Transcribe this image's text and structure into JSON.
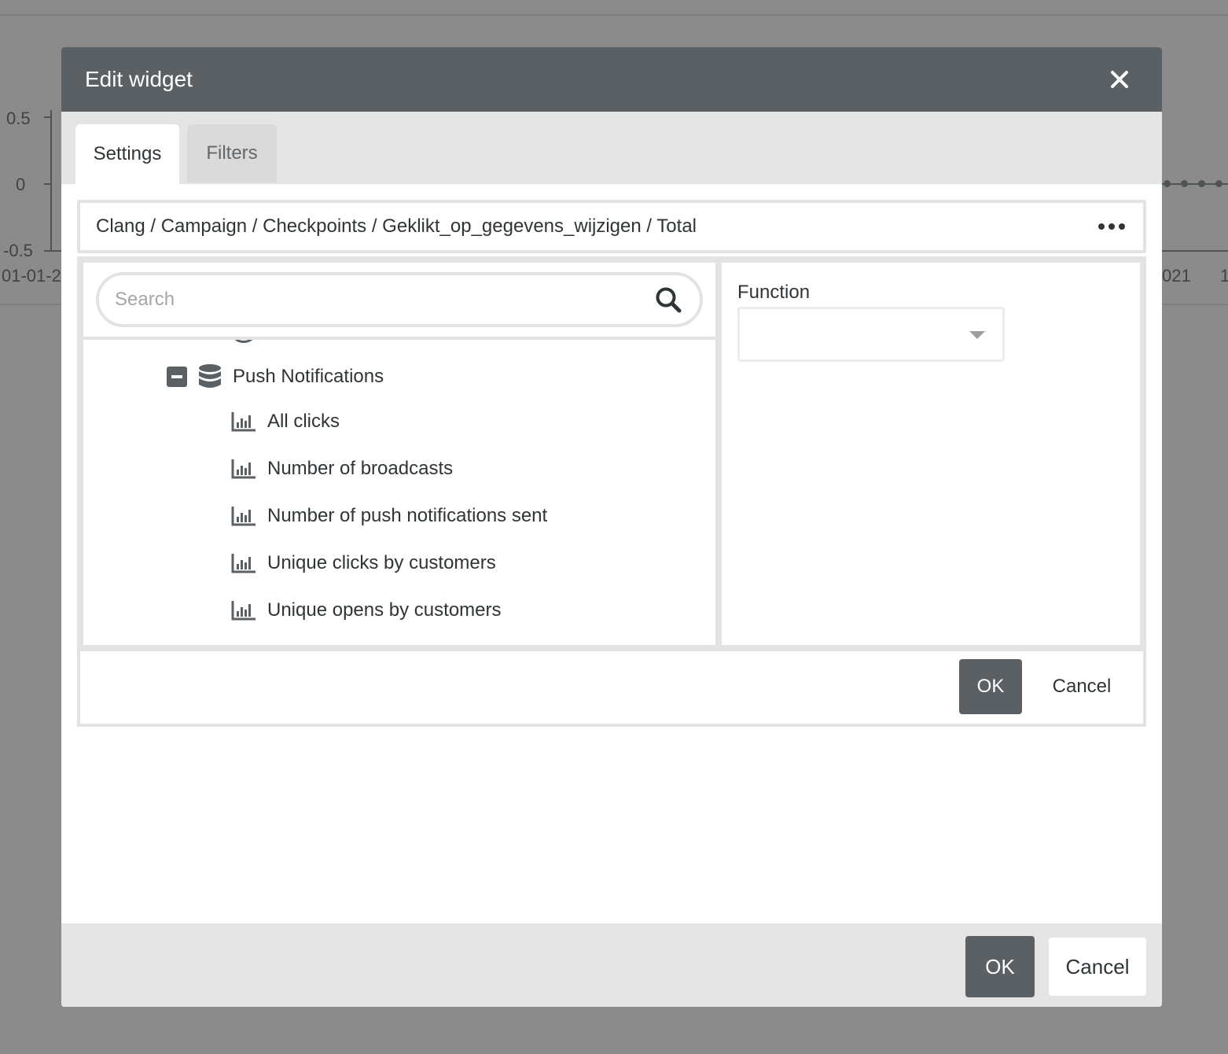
{
  "background": {
    "y_ticks": [
      "0.5",
      "0",
      "-0.5"
    ],
    "x_tick_left": "01-01-2",
    "x_tick_right": "021",
    "x_tick_far_right": "1"
  },
  "dialog": {
    "title": "Edit widget",
    "close_icon": "close-icon"
  },
  "tabs": [
    {
      "label": "Settings",
      "active": true
    },
    {
      "label": "Filters",
      "active": false
    }
  ],
  "path": {
    "text": "Clang / Campaign / Checkpoints / Geklikt_op_gegevens_wijzigen / Total",
    "more_icon": "more-horizontal-icon"
  },
  "search": {
    "placeholder": "Search",
    "value": "",
    "icon": "search-icon"
  },
  "tree": {
    "group": {
      "label": "Push Notifications",
      "icon": "database-icon",
      "expanded": true
    },
    "items": [
      {
        "label": "All clicks",
        "icon": "bar-chart-icon"
      },
      {
        "label": "Number of broadcasts",
        "icon": "bar-chart-icon"
      },
      {
        "label": "Number of push notifications sent",
        "icon": "bar-chart-icon"
      },
      {
        "label": "Unique clicks by customers",
        "icon": "bar-chart-icon"
      },
      {
        "label": "Unique opens by customers",
        "icon": "bar-chart-icon"
      }
    ]
  },
  "function": {
    "label": "Function",
    "selected": ""
  },
  "inner_actions": {
    "ok_label": "OK",
    "cancel_label": "Cancel"
  },
  "footer": {
    "ok_label": "OK",
    "cancel_label": "Cancel"
  },
  "colors": {
    "header_bg": "#5b6064",
    "overlay_bg": "#8b8b8b",
    "primary_button": "#5b6064"
  }
}
